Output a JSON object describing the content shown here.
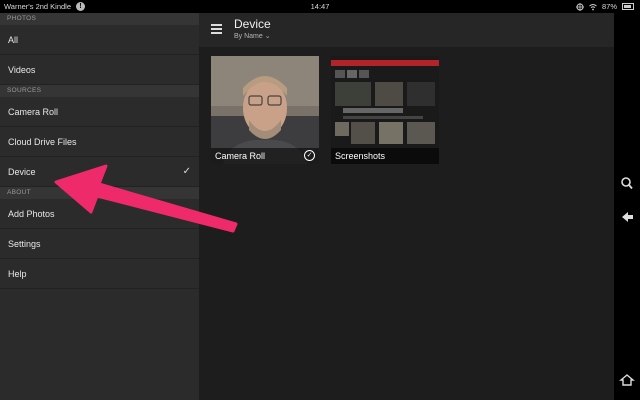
{
  "statusbar": {
    "device_name": "Warner's 2nd Kindle",
    "alert": "!",
    "time": "14:47",
    "battery": "87%"
  },
  "drawer": {
    "photos_header": "PHOTOS",
    "all": "All",
    "videos": "Videos",
    "sources_header": "SOURCES",
    "camera_roll": "Camera Roll",
    "cloud_drive": "Cloud Drive Files",
    "device": "Device",
    "device_check": "✓",
    "about_header": "ABOUT",
    "add_photos": "Add Photos",
    "settings": "Settings",
    "help": "Help"
  },
  "main": {
    "title": "Device",
    "sort": "By Name",
    "sort_chevron": "⌄",
    "folders": [
      {
        "label": "Camera Roll",
        "check": "✓"
      },
      {
        "label": "Screenshots"
      }
    ]
  },
  "nav": {
    "search_icon": "search-icon",
    "back_icon": "back-icon",
    "home_icon": "home-icon"
  },
  "colors": {
    "drawer_bg": "#2b2b2b",
    "main_bg": "#1d1d1d",
    "arrow": "#ee2a6a"
  }
}
